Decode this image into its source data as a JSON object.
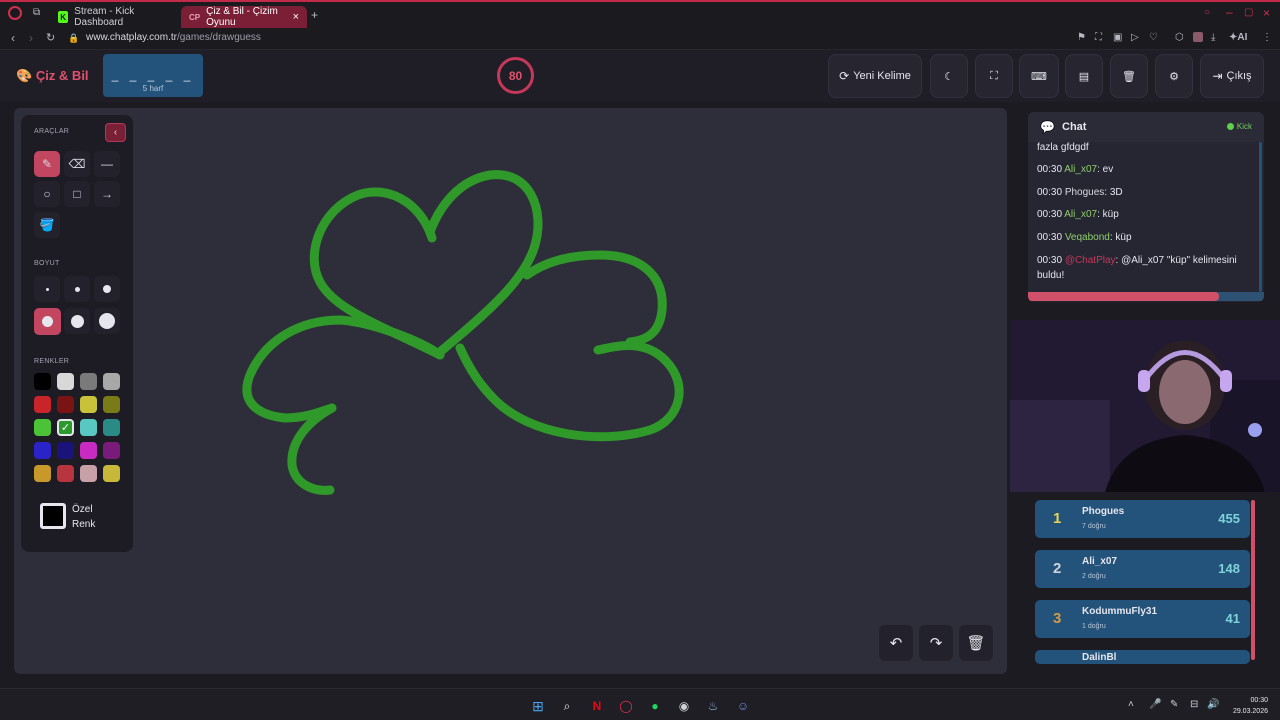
{
  "browser": {
    "tabs": [
      {
        "label": "Stream - Kick Dashboard",
        "favicon": "K"
      },
      {
        "label": "Çiz & Bil - Çizim Oyunu",
        "favicon": "CP"
      }
    ],
    "url_host": "www.chatplay.com.tr",
    "url_path": "/games/drawguess",
    "ai_label": "AI"
  },
  "header": {
    "brand": "Çiz & Bil",
    "word_mask": "_ _ _ _ _",
    "word_hint": "5 harf",
    "timer": "80",
    "new_word": "Yeni Kelime",
    "exit": "Çıkış"
  },
  "tools": {
    "section_tools": "ARAÇLAR",
    "section_size": "BOYUT",
    "section_colors": "RENKLER",
    "custom_color": "Özel Renk",
    "colors": [
      "#000000",
      "#d8d8d8",
      "#7a7a7a",
      "#a8a8a8",
      "#c8242a",
      "#7a1414",
      "#c8c23a",
      "#7a7a18",
      "#4cc236",
      "#2a9a2a",
      "#5ac8c2",
      "#2a8a86",
      "#2a24c8",
      "#1a147a",
      "#c82ac2",
      "#7a1a7a",
      "#c8982a",
      "#b8343e",
      "#c8a0a8",
      "#c8b83a"
    ],
    "selected_color": "#2a9a2a"
  },
  "chat": {
    "title": "Chat",
    "platform": "Kick",
    "overflow_line": "fazla gfdgdf",
    "messages": [
      {
        "time": "00:30",
        "user": "Ali_x07",
        "text": ": ev"
      },
      {
        "time": "00:30",
        "user": "Phogues",
        "text": ": 3D"
      },
      {
        "time": "00:30",
        "user": "Ali_x07",
        "text": ": küp"
      },
      {
        "time": "00:30",
        "user": "Veqabond",
        "text": ": küp"
      }
    ],
    "system": {
      "time": "00:30",
      "user": "@ChatPlay",
      "text": ": @Ali_x07 \"küp\" kelimesini buldu!"
    },
    "progress": 0.81
  },
  "leaderboard": [
    {
      "rank": "1",
      "name": "Phogues",
      "sub": "7 doğru",
      "score": "455",
      "rank_color": "#e8d35a"
    },
    {
      "rank": "2",
      "name": "Ali_x07",
      "sub": "2 doğru",
      "score": "148",
      "rank_color": "#cfd4dc"
    },
    {
      "rank": "3",
      "name": "KodummuFly31",
      "sub": "1 doğru",
      "score": "41",
      "rank_color": "#d19a4a"
    },
    {
      "rank": "",
      "name": "DalinBl",
      "sub": "",
      "score": "",
      "rank_color": "#cfd4dc"
    }
  ],
  "taskbar": {
    "time": "00:30",
    "date": "29.03.2026"
  }
}
